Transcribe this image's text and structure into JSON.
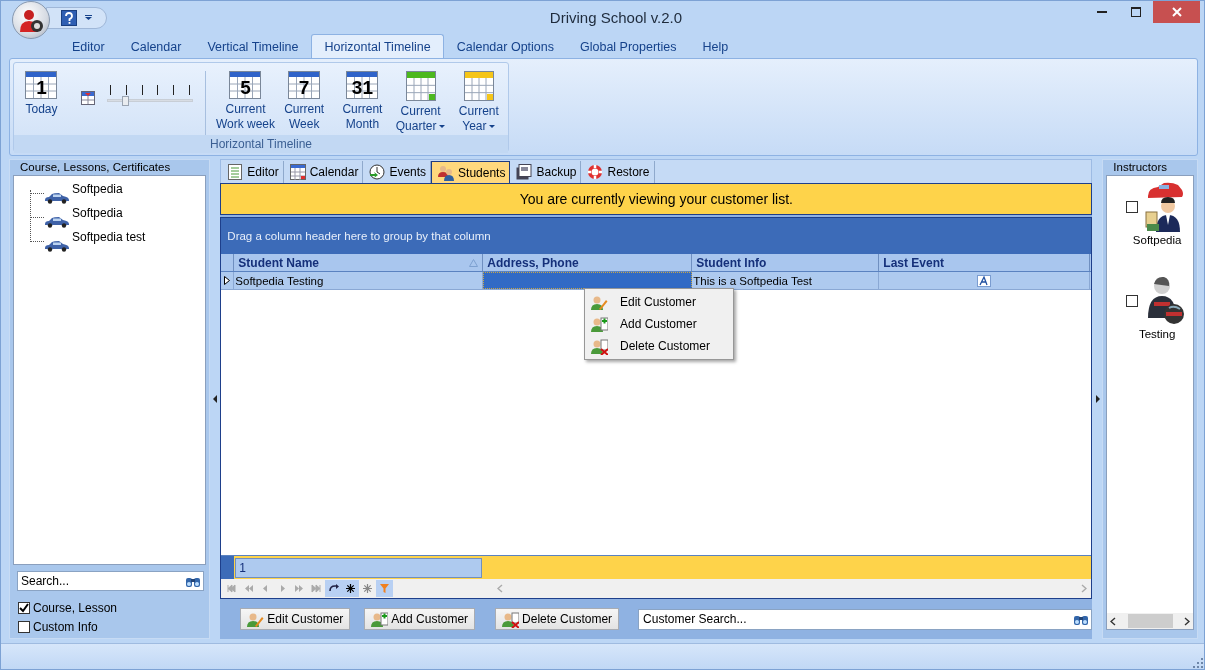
{
  "window": {
    "title": "Driving School v.2.0"
  },
  "ribbon": {
    "tabs": [
      {
        "label": "Editor",
        "selected": false
      },
      {
        "label": "Calendar",
        "selected": false
      },
      {
        "label": "Vertical Timeline",
        "selected": false
      },
      {
        "label": "Horizontal Timeline",
        "selected": true
      },
      {
        "label": "Calendar Options",
        "selected": false
      },
      {
        "label": "Global Properties",
        "selected": false
      },
      {
        "label": "Help",
        "selected": false
      }
    ],
    "today": {
      "day": "1",
      "label": "Today"
    },
    "zoom": {
      "level": 0.2
    },
    "buttons": [
      {
        "kind": "day",
        "day": "5",
        "lines": [
          "Current",
          "Work week"
        ],
        "dropdown": false
      },
      {
        "kind": "day",
        "day": "7",
        "lines": [
          "Current",
          "Week"
        ],
        "dropdown": false
      },
      {
        "kind": "day",
        "day": "31",
        "lines": [
          "Current",
          "Month"
        ],
        "dropdown": false
      },
      {
        "kind": "grid",
        "color": "#4cb81e",
        "lines": [
          "Current",
          "Quarter"
        ],
        "dropdown": true
      },
      {
        "kind": "grid",
        "color": "#f5c518",
        "lines": [
          "Current",
          "Year"
        ],
        "dropdown": true
      }
    ],
    "group_label": "Horizontal Timeline"
  },
  "left_panel": {
    "title": "Course, Lessons, Certificates",
    "tree": [
      {
        "label": "Softpedia"
      },
      {
        "label": "Softpedia"
      },
      {
        "label": "Softpedia test"
      }
    ],
    "search": {
      "placeholder": "Search..."
    },
    "options": [
      {
        "label": "Course, Lesson",
        "checked": true
      },
      {
        "label": "Custom Info",
        "checked": false
      }
    ]
  },
  "center": {
    "tabs": [
      {
        "label": "Editor",
        "kind": "editor",
        "selected": false
      },
      {
        "label": "Calendar",
        "kind": "calendar",
        "selected": false
      },
      {
        "label": "Events",
        "kind": "events",
        "selected": false
      },
      {
        "label": "Students",
        "kind": "students",
        "selected": true
      },
      {
        "label": "Backup",
        "kind": "backup",
        "selected": false
      },
      {
        "label": "Restore",
        "kind": "restore",
        "selected": false
      }
    ],
    "banner": "You are currently viewing your customer list.",
    "group_hint": "Drag a column header here to group by that column",
    "table": {
      "columns": [
        {
          "label": "Student Name",
          "sorted": true
        },
        {
          "label": "Address, Phone",
          "sorted": false
        },
        {
          "label": "Student Info",
          "sorted": false
        },
        {
          "label": "Last Event",
          "sorted": false
        }
      ],
      "rows": [
        {
          "selected": true,
          "cells": [
            {
              "kind": "text",
              "text": "Softpedia Testing",
              "focused": false
            },
            {
              "kind": "empty",
              "focused": true
            },
            {
              "kind": "text",
              "text": "This is a Softpedia Test",
              "focused": false
            },
            {
              "kind": "icon",
              "focused": false
            }
          ]
        }
      ]
    },
    "context_menu": [
      {
        "label": "Edit Customer",
        "kind": "edit"
      },
      {
        "label": "Add Customer",
        "kind": "add"
      },
      {
        "label": "Delete Customer",
        "kind": "delete"
      }
    ],
    "footer": {
      "count": "1"
    },
    "buttons": [
      {
        "label": "Edit Customer",
        "kind": "edit"
      },
      {
        "label": "Add Customer",
        "kind": "add"
      },
      {
        "label": "Delete Customer",
        "kind": "delete"
      }
    ],
    "customer_search": {
      "placeholder": "Customer Search..."
    }
  },
  "right_panel": {
    "title": "Instructors",
    "instructors": [
      {
        "name": "Softpedia",
        "checked": false,
        "kind": "car"
      },
      {
        "name": "Testing",
        "checked": false,
        "kind": "helmet"
      }
    ]
  }
}
